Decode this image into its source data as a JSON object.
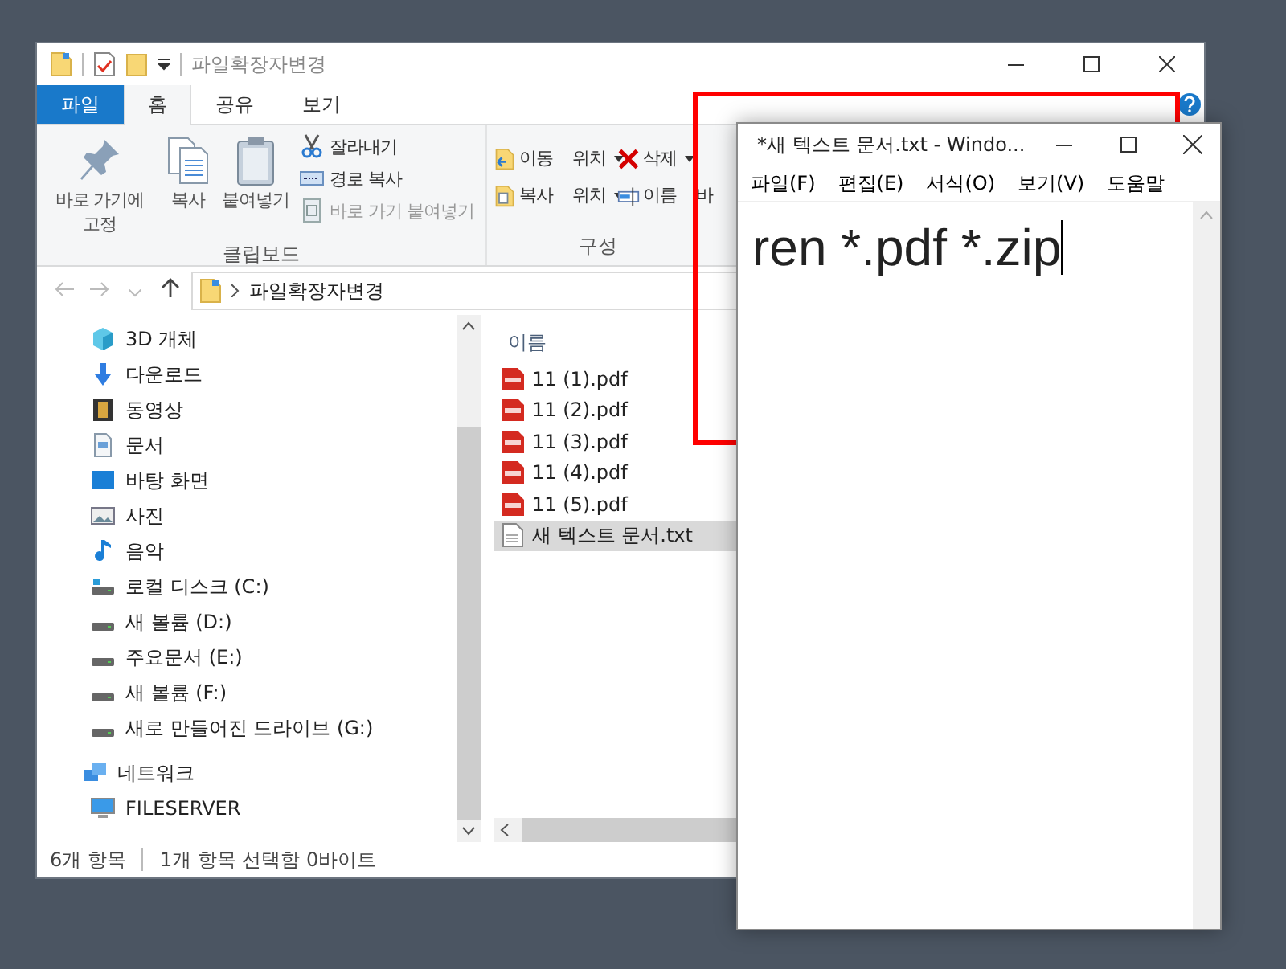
{
  "explorer": {
    "title": "파일확장자변경",
    "ribbon_tabs": [
      {
        "label": "파일",
        "kind": "file",
        "selected": false
      },
      {
        "label": "홈",
        "kind": "tab",
        "selected": true
      },
      {
        "label": "공유",
        "kind": "tab",
        "selected": false
      },
      {
        "label": "보기",
        "kind": "tab",
        "selected": false
      }
    ],
    "clipboard": {
      "label": "클립보드",
      "large_buttons": [
        {
          "label": "바로 가기에 고정",
          "disabled": false
        },
        {
          "label": "복사",
          "disabled": false
        },
        {
          "label": "붙여넣기",
          "disabled": false
        }
      ],
      "small_buttons": [
        {
          "label": "잘라내기",
          "disabled": false
        },
        {
          "label": "경로 복사",
          "disabled": false
        },
        {
          "label": "바로 가기 붙여넣기",
          "disabled": true
        }
      ]
    },
    "organize": {
      "label": "구성",
      "buttons": [
        {
          "label": "이동 위치",
          "dropdown": true
        },
        {
          "label": "삭제",
          "dropdown": true
        },
        {
          "label": "복사 위치",
          "dropdown": true
        },
        {
          "label": "이름 바",
          "dropdown": false
        }
      ]
    },
    "address": {
      "path": "파일확장자변경"
    },
    "nav": [
      {
        "label": "3D 개체"
      },
      {
        "label": "다운로드"
      },
      {
        "label": "동영상"
      },
      {
        "label": "문서"
      },
      {
        "label": "바탕 화면"
      },
      {
        "label": "사진"
      },
      {
        "label": "음악"
      },
      {
        "label": "로컬 디스크 (C:)"
      },
      {
        "label": "새 볼륨 (D:)"
      },
      {
        "label": "주요문서 (E:)"
      },
      {
        "label": "새 볼륨 (F:)"
      },
      {
        "label": "새로 만들어진 드라이브 (G:)"
      },
      {
        "label": "네트워크",
        "children": [
          {
            "label": "FILESERVER"
          }
        ]
      }
    ],
    "column_header": "이름",
    "files": [
      {
        "name": "11 (1).pdf",
        "kind": "pdf",
        "selected": false
      },
      {
        "name": "11 (2).pdf",
        "kind": "pdf",
        "selected": false
      },
      {
        "name": "11 (3).pdf",
        "kind": "pdf",
        "selected": false
      },
      {
        "name": "11 (4).pdf",
        "kind": "pdf",
        "selected": false
      },
      {
        "name": "11 (5).pdf",
        "kind": "pdf",
        "selected": false
      },
      {
        "name": "새 텍스트 문서.txt",
        "kind": "txt",
        "selected": true
      }
    ],
    "status_bar": [
      "6개 항목",
      "1개 항목 선택함 0바이트"
    ]
  },
  "notepad": {
    "title": "*새 텍스트 문서.txt - Windo...",
    "menu": [
      "파일(F)",
      "편집(E)",
      "서식(O)",
      "보기(V)",
      "도움말"
    ],
    "content": "ren *.pdf *.zip"
  }
}
